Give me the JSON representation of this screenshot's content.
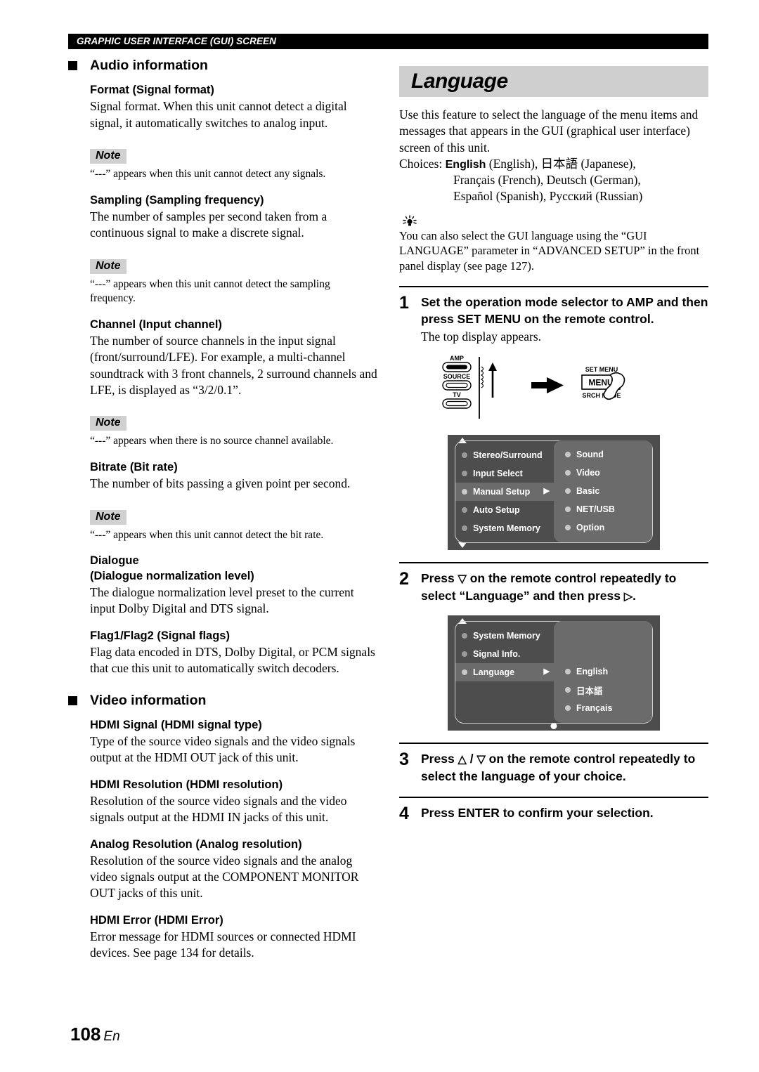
{
  "running_head": "GRAPHIC USER INTERFACE (GUI) SCREEN",
  "footer": {
    "page_number": "108",
    "lang_code": "En"
  },
  "left_column": {
    "section_audio": {
      "heading": "Audio information",
      "entries": [
        {
          "title": "Format (Signal format)",
          "body": "Signal format. When this unit cannot detect a digital signal, it automatically switches to analog input.",
          "note_label": "Note",
          "note": "“---” appears when this unit cannot detect any signals."
        },
        {
          "title": "Sampling (Sampling frequency)",
          "body": "The number of samples per second taken from a continuous signal to make a discrete signal.",
          "note_label": "Note",
          "note": "“---” appears when this unit cannot detect the sampling frequency."
        },
        {
          "title": "Channel (Input channel)",
          "body": "The number of source channels in the input signal (front/surround/LFE). For example, a multi-channel soundtrack with 3 front channels, 2 surround channels and LFE, is displayed as “3/2/0.1”.",
          "note_label": "Note",
          "note": "“---” appears when there is no source channel available."
        },
        {
          "title": "Bitrate (Bit rate)",
          "body": "The number of bits passing a given point per second.",
          "note_label": "Note",
          "note": "“---” appears when this unit cannot detect the bit rate."
        },
        {
          "title": "Dialogue",
          "title2": "(Dialogue normalization level)",
          "body": "The dialogue normalization level preset to the current input Dolby Digital and DTS signal."
        },
        {
          "title": "Flag1/Flag2 (Signal flags)",
          "body": "Flag data encoded in DTS, Dolby Digital, or PCM signals that cue this unit to automatically switch decoders."
        }
      ]
    },
    "section_video": {
      "heading": "Video information",
      "entries": [
        {
          "title": "HDMI Signal (HDMI signal type)",
          "body": "Type of the source video signals and the video signals output at the HDMI OUT jack of this unit."
        },
        {
          "title": "HDMI Resolution (HDMI resolution)",
          "body": "Resolution of the source video signals and the video signals output at the HDMI IN jacks of this unit."
        },
        {
          "title": "Analog Resolution (Analog resolution)",
          "body": "Resolution of the source video signals and the analog video signals output at the COMPONENT MONITOR OUT jacks of this unit."
        },
        {
          "title": "HDMI Error (HDMI Error)",
          "body": "Error message for HDMI sources or connected HDMI devices. See page 134 for details."
        }
      ]
    }
  },
  "right_column": {
    "title": "Language",
    "intro": "Use this feature to select the language of the menu items and messages that appears in the GUI (graphical user interface) screen of this unit.",
    "choices_label": "Choices:",
    "choices_line1_bold": "English",
    "choices_line1_rest": " (English), 日本語  (Japanese),",
    "choices_line2": "Français (French), Deutsch (German),",
    "choices_line3": "Español (Spanish), Русский (Russian)",
    "tip_text": "You can also select the GUI language using the “GUI LANGUAGE” parameter in “ADVANCED SETUP” in the front panel display (see page 127).",
    "steps": [
      {
        "num": "1",
        "title": "Set the operation mode selector to AMP and then press SET MENU on the remote control.",
        "sub": "The top display appears."
      },
      {
        "num": "2",
        "title_pre": "Press ",
        "tri1": "▽",
        "title_mid": " on the remote control repeatedly to select “Language” and then press ",
        "tri2": "▷",
        "title_post": "."
      },
      {
        "num": "3",
        "title_pre": "Press ",
        "tri1": "△",
        "title_mid": " / ",
        "tri2": "▽",
        "title_post": " on the remote control repeatedly to select the language of your choice."
      },
      {
        "num": "4",
        "title": "Press ENTER to confirm your selection."
      }
    ],
    "remote_figure": {
      "amp_label": "AMP",
      "source_label": "SOURCE",
      "tv_label": "TV",
      "set_menu_label": "SET MENU",
      "menu_label": "MENU",
      "srch_mode_label": "SRCH MODE"
    },
    "gui_screen_1": {
      "left_items": [
        {
          "label": "Stereo/Surround",
          "selected": false
        },
        {
          "label": "Input Select",
          "selected": false
        },
        {
          "label": "Manual Setup",
          "selected": true,
          "arrow": "▶"
        },
        {
          "label": "Auto Setup",
          "selected": false
        },
        {
          "label": "System Memory",
          "selected": false
        }
      ],
      "right_items": [
        {
          "label": "Sound"
        },
        {
          "label": "Video"
        },
        {
          "label": "Basic"
        },
        {
          "label": "NET/USB"
        },
        {
          "label": "Option"
        }
      ]
    },
    "gui_screen_2": {
      "left_items": [
        {
          "label": "System Memory",
          "selected": false
        },
        {
          "label": "Signal Info.",
          "selected": false
        },
        {
          "label": "Language",
          "selected": true,
          "arrow": "▶"
        },
        {
          "label": "",
          "selected": false,
          "empty": true
        },
        {
          "label": "",
          "selected": false,
          "empty": true
        }
      ],
      "right_items": [
        {
          "label": ""
        },
        {
          "label": ""
        },
        {
          "label": "English"
        },
        {
          "label": "日本語"
        },
        {
          "label": "Français"
        }
      ]
    }
  },
  "colors": {
    "gui_bg": "#4d4d4d",
    "gui_panel": "#6b6b6b",
    "note_badge_bg": "#d0d0d0",
    "title_bar_bg": "#cfcfcf",
    "runhead_bg": "#000000"
  }
}
